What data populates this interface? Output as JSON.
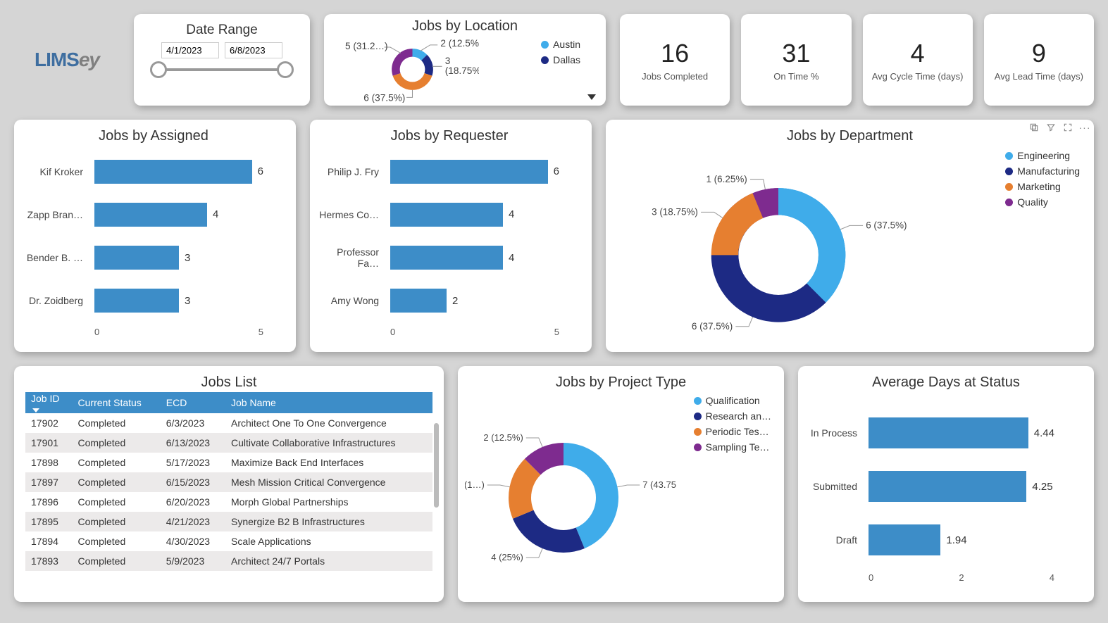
{
  "brand": {
    "prefix": "LIMS",
    "suffix": "ey"
  },
  "date_range": {
    "title": "Date Range",
    "start": "4/1/2023",
    "end": "6/8/2023"
  },
  "colors": {
    "blue": "#3facea",
    "navy": "#1d2a84",
    "orange": "#e67f30",
    "purple": "#7e2b8f",
    "bar": "#3d8dc8"
  },
  "kpis": [
    {
      "value": "16",
      "label": "Jobs Completed"
    },
    {
      "value": "31",
      "label": "On Time %"
    },
    {
      "value": "4",
      "label": "Avg Cycle Time (days)"
    },
    {
      "value": "9",
      "label": "Avg Lead Time (days)"
    }
  ],
  "jobs_by_location": {
    "title": "Jobs by Location",
    "legend": [
      "Austin",
      "Dallas"
    ],
    "legend_colors": [
      "blue",
      "navy"
    ],
    "labels": [
      "2 (12.5%)",
      "3 (18.75%)",
      "6 (37.5%)",
      "5 (31.2…)"
    ]
  },
  "jobs_by_assigned": {
    "title": "Jobs by Assigned",
    "axis": [
      "0",
      "5"
    ]
  },
  "jobs_by_requester": {
    "title": "Jobs by Requester",
    "axis": [
      "0",
      "5"
    ]
  },
  "jobs_by_department": {
    "title": "Jobs by Department",
    "legend": [
      "Engineering",
      "Manufacturing",
      "Marketing",
      "Quality"
    ],
    "legend_colors": [
      "blue",
      "navy",
      "orange",
      "purple"
    ],
    "labels": [
      "6 (37.5%)",
      "6 (37.5%)",
      "3 (18.75%)",
      "1 (6.25%)"
    ]
  },
  "jobs_list": {
    "title": "Jobs List",
    "columns": [
      "Job ID",
      "Current Status",
      "ECD",
      "Job Name"
    ],
    "rows": [
      [
        "17902",
        "Completed",
        "6/3/2023",
        "Architect One To One Convergence"
      ],
      [
        "17901",
        "Completed",
        "6/13/2023",
        "Cultivate Collaborative Infrastructures"
      ],
      [
        "17898",
        "Completed",
        "5/17/2023",
        "Maximize Back End Interfaces"
      ],
      [
        "17897",
        "Completed",
        "6/15/2023",
        "Mesh Mission Critical Convergence"
      ],
      [
        "17896",
        "Completed",
        "6/20/2023",
        "Morph Global Partnerships"
      ],
      [
        "17895",
        "Completed",
        "4/21/2023",
        "Synergize B2 B Infrastructures"
      ],
      [
        "17894",
        "Completed",
        "4/30/2023",
        "Scale Applications"
      ],
      [
        "17893",
        "Completed",
        "5/9/2023",
        "Architect 24/7 Portals"
      ]
    ]
  },
  "jobs_by_project_type": {
    "title": "Jobs by Project Type",
    "legend": [
      "Qualification",
      "Research an…",
      "Periodic Tes…",
      "Sampling Te…"
    ],
    "legend_colors": [
      "blue",
      "navy",
      "orange",
      "purple"
    ],
    "labels": [
      "7 (43.75%)",
      "4 (25%)",
      "3 (1…)",
      "2 (12.5%)"
    ]
  },
  "avg_days_at_status": {
    "title": "Average Days at Status",
    "axis": [
      "0",
      "2",
      "4"
    ]
  },
  "chart_data": [
    {
      "type": "pie",
      "title": "Jobs by Location",
      "series": [
        {
          "name": "Austin (a)",
          "value": 2,
          "pct": 12.5
        },
        {
          "name": "Austin (b)",
          "value": 3,
          "pct": 18.75
        },
        {
          "name": "Dallas (a)",
          "value": 6,
          "pct": 37.5
        },
        {
          "name": "Dallas (b)",
          "value": 5,
          "pct": 31.25
        }
      ],
      "legend": [
        "Austin",
        "Dallas"
      ]
    },
    {
      "type": "bar",
      "title": "Jobs by Assigned",
      "orientation": "horizontal",
      "categories": [
        "Kif Kroker",
        "Zapp Bran…",
        "Bender B. …",
        "Dr. Zoidberg"
      ],
      "values": [
        6,
        4,
        3,
        3
      ],
      "xlim": [
        0,
        6
      ]
    },
    {
      "type": "bar",
      "title": "Jobs by Requester",
      "orientation": "horizontal",
      "categories": [
        "Philip J. Fry",
        "Hermes Co…",
        "Professor Fa…",
        "Amy Wong"
      ],
      "values": [
        6,
        4,
        4,
        2
      ],
      "xlim": [
        0,
        6
      ]
    },
    {
      "type": "pie",
      "title": "Jobs by Department",
      "series": [
        {
          "name": "Engineering",
          "value": 6,
          "pct": 37.5
        },
        {
          "name": "Manufacturing",
          "value": 6,
          "pct": 37.5
        },
        {
          "name": "Marketing",
          "value": 3,
          "pct": 18.75
        },
        {
          "name": "Quality",
          "value": 1,
          "pct": 6.25
        }
      ]
    },
    {
      "type": "table",
      "title": "Jobs List",
      "columns": [
        "Job ID",
        "Current Status",
        "ECD",
        "Job Name"
      ],
      "rows": [
        [
          "17902",
          "Completed",
          "6/3/2023",
          "Architect One To One Convergence"
        ],
        [
          "17901",
          "Completed",
          "6/13/2023",
          "Cultivate Collaborative Infrastructures"
        ],
        [
          "17898",
          "Completed",
          "5/17/2023",
          "Maximize Back End Interfaces"
        ],
        [
          "17897",
          "Completed",
          "6/15/2023",
          "Mesh Mission Critical Convergence"
        ],
        [
          "17896",
          "Completed",
          "6/20/2023",
          "Morph Global Partnerships"
        ],
        [
          "17895",
          "Completed",
          "4/21/2023",
          "Synergize B2 B Infrastructures"
        ],
        [
          "17894",
          "Completed",
          "4/30/2023",
          "Scale Applications"
        ],
        [
          "17893",
          "Completed",
          "5/9/2023",
          "Architect 24/7 Portals"
        ]
      ]
    },
    {
      "type": "pie",
      "title": "Jobs by Project Type",
      "series": [
        {
          "name": "Qualification",
          "value": 7,
          "pct": 43.75
        },
        {
          "name": "Research and…",
          "value": 4,
          "pct": 25.0
        },
        {
          "name": "Periodic Testing",
          "value": 3,
          "pct": 18.75
        },
        {
          "name": "Sampling Testing",
          "value": 2,
          "pct": 12.5
        }
      ]
    },
    {
      "type": "bar",
      "title": "Average Days at Status",
      "orientation": "horizontal",
      "categories": [
        "In Process",
        "Submitted",
        "Draft"
      ],
      "values": [
        4.44,
        4.25,
        1.94
      ],
      "xlim": [
        0,
        5
      ]
    }
  ]
}
